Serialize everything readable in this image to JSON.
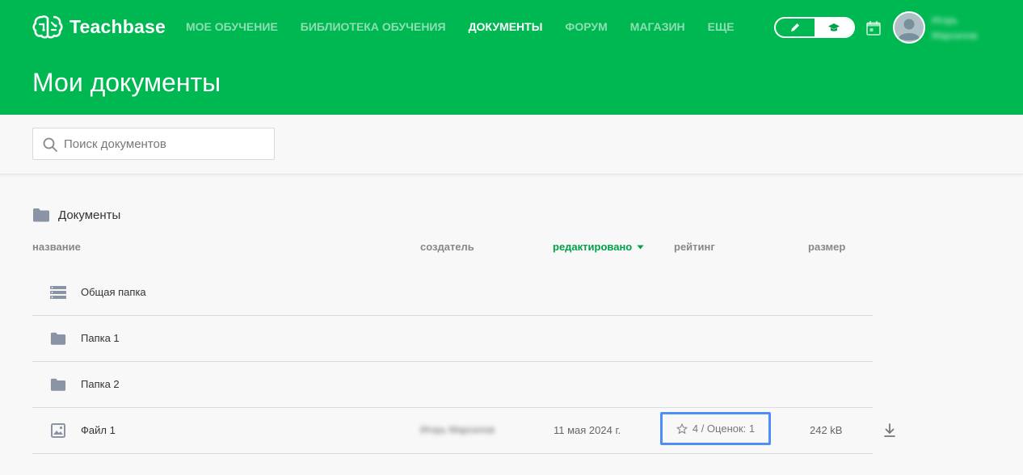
{
  "app": {
    "brand": "Teachbase"
  },
  "nav": [
    {
      "label": "МОЕ ОБУЧЕНИЕ",
      "active": false
    },
    {
      "label": "БИБЛИОТЕКА ОБУЧЕНИЯ",
      "active": false
    },
    {
      "label": "ДОКУМЕНТЫ",
      "active": true
    },
    {
      "label": "ФОРУМ",
      "active": false
    },
    {
      "label": "МАГАЗИН",
      "active": false
    },
    {
      "label": "ЕЩЕ",
      "active": false
    }
  ],
  "mode_toggle": {
    "left_icon": "pencil-icon",
    "right_icon": "graduation-cap-icon",
    "active": "right"
  },
  "user": {
    "name": "Игорь Марсилов"
  },
  "page": {
    "title": "Мои документы"
  },
  "search": {
    "placeholder": "Поиск документов",
    "value": ""
  },
  "section": {
    "title": "Документы",
    "icon": "folder-icon"
  },
  "columns": {
    "name": "название",
    "creator": "создатель",
    "edited": "редактировано",
    "rating": "рейтинг",
    "size": "размер"
  },
  "rows": [
    {
      "name": "Общая папка",
      "icon": "shared-folder-icon"
    },
    {
      "name": "Папка 1",
      "icon": "folder-icon"
    },
    {
      "name": "Папка 2",
      "icon": "folder-icon"
    },
    {
      "name": "Файл 1",
      "icon": "image-file-icon",
      "creator": "Игорь Марсилов",
      "edited": "11 мая 2024 г.",
      "rating": "4 / Оценок: 1",
      "size": "242 kB"
    }
  ],
  "colors": {
    "brand": "#00b852",
    "accent_green_text": "#00a04a",
    "highlight": "#4f8ef7",
    "icon_gray": "#8a94a6"
  }
}
